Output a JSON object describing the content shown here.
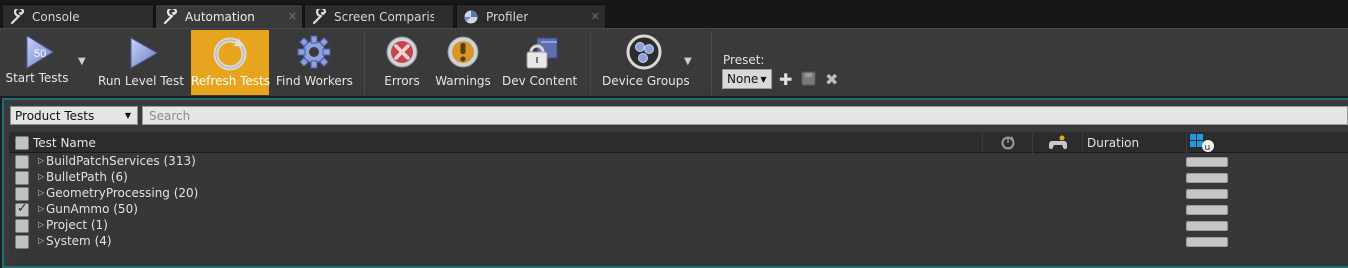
{
  "tabs": [
    {
      "label": "Console",
      "icon": "wrench-icon",
      "active": false
    },
    {
      "label": "Automation",
      "icon": "wrench-icon",
      "active": true
    },
    {
      "label": "Screen Compariso",
      "icon": "wrench-icon",
      "active": false
    },
    {
      "label": "Profiler",
      "icon": "profiler-icon",
      "active": false
    }
  ],
  "toolbar": {
    "start_tests": {
      "label": "Start Tests",
      "count": "50"
    },
    "run_level_test": {
      "label": "Run Level Test"
    },
    "refresh_tests": {
      "label": "Refresh Tests"
    },
    "find_workers": {
      "label": "Find Workers"
    },
    "errors": {
      "label": "Errors"
    },
    "warnings": {
      "label": "Warnings"
    },
    "dev_content": {
      "label": "Dev Content"
    },
    "device_groups": {
      "label": "Device Groups"
    },
    "preset": {
      "label": "Preset:",
      "value": "None"
    }
  },
  "filter": {
    "selected": "Product Tests",
    "search_placeholder": "Search"
  },
  "grid": {
    "columns": {
      "test_name": "Test Name",
      "duration": "Duration"
    },
    "rows": [
      {
        "label": "BuildPatchServices (313)",
        "checked": false
      },
      {
        "label": "BulletPath (6)",
        "checked": false
      },
      {
        "label": "GeometryProcessing (20)",
        "checked": false
      },
      {
        "label": "GunAmmo (50)",
        "checked": true
      },
      {
        "label": "Project (1)",
        "checked": false
      },
      {
        "label": "System (4)",
        "checked": false
      }
    ]
  },
  "colors": {
    "accent_highlight": "#e8a41e",
    "panel_border": "#1c6f76",
    "play_blue": "#7d8ed6",
    "errors_red": "#c8444a",
    "warnings_orange": "#d99628"
  }
}
